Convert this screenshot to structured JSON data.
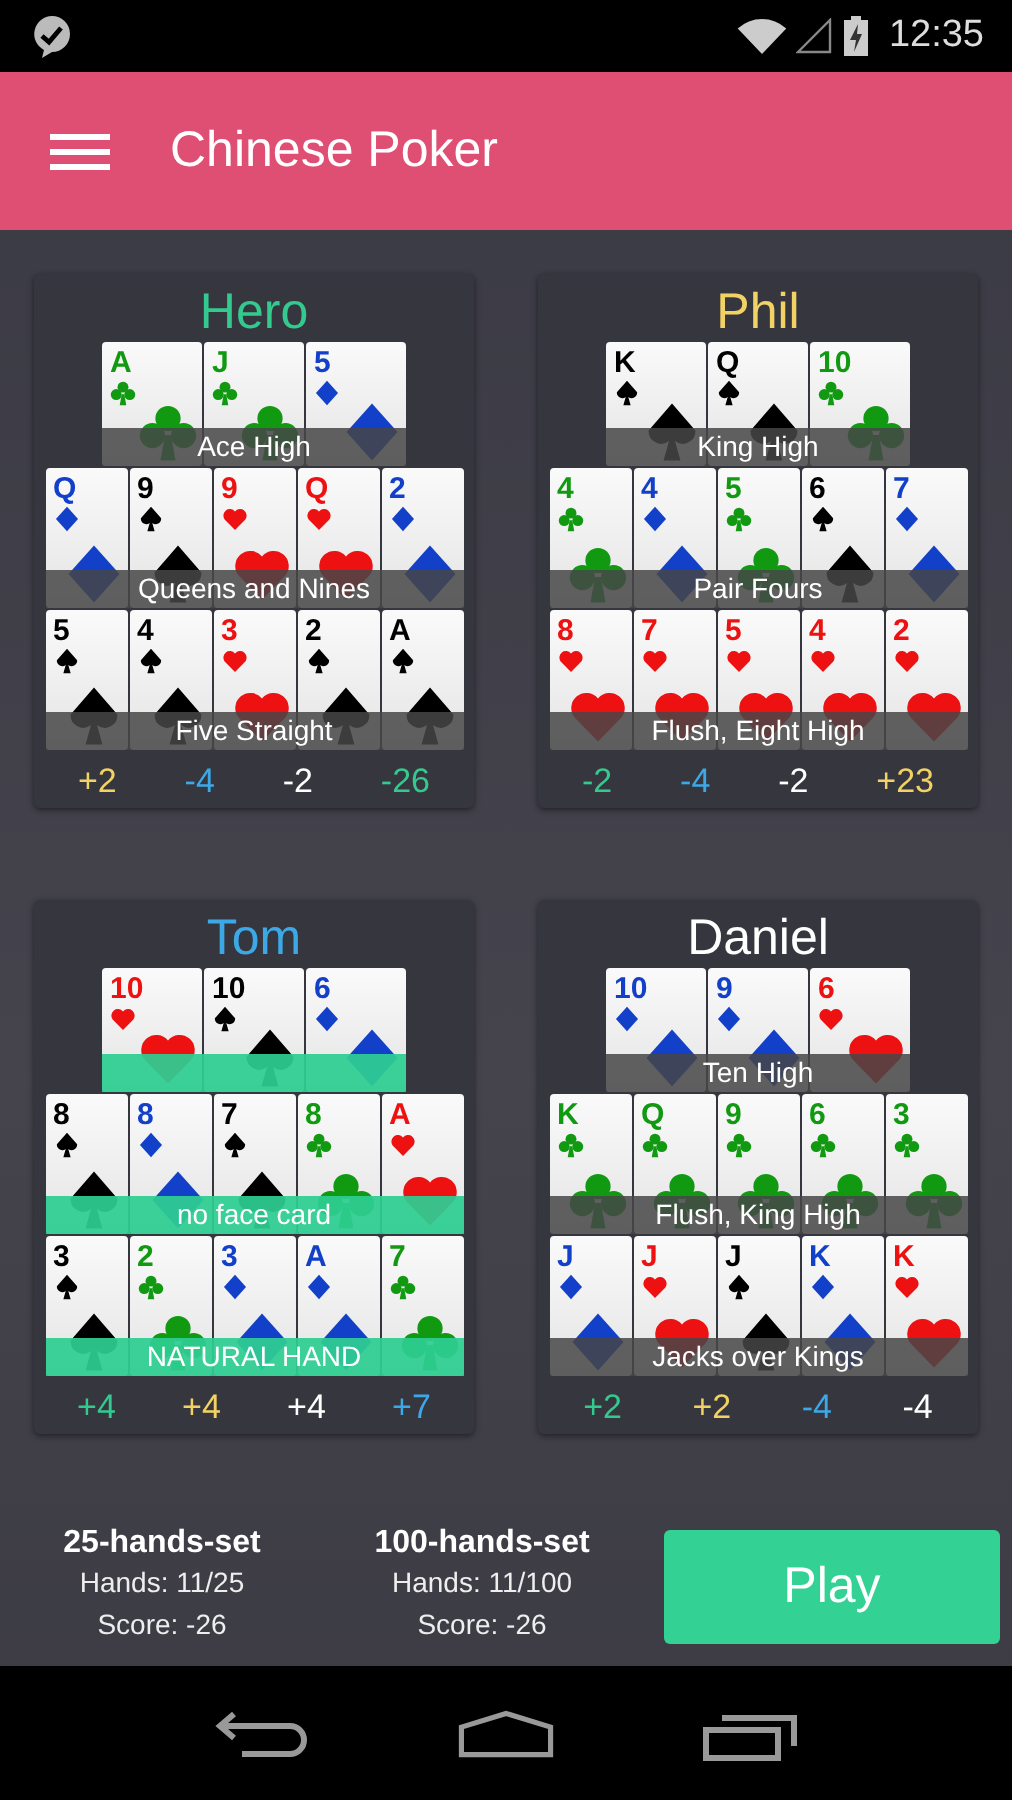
{
  "status_bar": {
    "time": "12:35"
  },
  "app_bar": {
    "title": "Chinese Poker"
  },
  "players": [
    {
      "name": "Hero",
      "color": "#34c98e",
      "rows": [
        {
          "label": "Ace High",
          "highlight": false,
          "cards": [
            {
              "rank": "A",
              "kind": "clubs"
            },
            {
              "rank": "J",
              "kind": "clubs"
            },
            {
              "rank": "5",
              "kind": "diamonds"
            }
          ]
        },
        {
          "label": "Queens and Nines",
          "highlight": false,
          "cards": [
            {
              "rank": "Q",
              "kind": "diamonds"
            },
            {
              "rank": "9",
              "kind": "spades"
            },
            {
              "rank": "9",
              "kind": "hearts"
            },
            {
              "rank": "Q",
              "kind": "hearts"
            },
            {
              "rank": "2",
              "kind": "diamonds"
            }
          ]
        },
        {
          "label": "Five Straight",
          "highlight": false,
          "cards": [
            {
              "rank": "5",
              "kind": "spades"
            },
            {
              "rank": "4",
              "kind": "spades"
            },
            {
              "rank": "3",
              "kind": "hearts"
            },
            {
              "rank": "2",
              "kind": "spades"
            },
            {
              "rank": "A",
              "kind": "spades"
            }
          ]
        }
      ],
      "scores": [
        {
          "text": "+2",
          "color": "#f2d264"
        },
        {
          "text": "-4",
          "color": "#3da8e6"
        },
        {
          "text": "-2",
          "color": "#ffffff"
        },
        {
          "text": "-26",
          "color": "#34c98e"
        }
      ]
    },
    {
      "name": "Phil",
      "color": "#f2d264",
      "rows": [
        {
          "label": "King High",
          "highlight": false,
          "cards": [
            {
              "rank": "K",
              "kind": "spades"
            },
            {
              "rank": "Q",
              "kind": "spades"
            },
            {
              "rank": "10",
              "kind": "clubs"
            }
          ]
        },
        {
          "label": "Pair Fours",
          "highlight": false,
          "cards": [
            {
              "rank": "4",
              "kind": "clubs"
            },
            {
              "rank": "4",
              "kind": "diamonds"
            },
            {
              "rank": "5",
              "kind": "clubs"
            },
            {
              "rank": "6",
              "kind": "spades"
            },
            {
              "rank": "7",
              "kind": "diamonds"
            }
          ]
        },
        {
          "label": "Flush, Eight High",
          "highlight": false,
          "cards": [
            {
              "rank": "8",
              "kind": "hearts"
            },
            {
              "rank": "7",
              "kind": "hearts"
            },
            {
              "rank": "5",
              "kind": "hearts"
            },
            {
              "rank": "4",
              "kind": "hearts"
            },
            {
              "rank": "2",
              "kind": "hearts"
            }
          ]
        }
      ],
      "scores": [
        {
          "text": "-2",
          "color": "#34c98e"
        },
        {
          "text": "-4",
          "color": "#3da8e6"
        },
        {
          "text": "-2",
          "color": "#ffffff"
        },
        {
          "text": "+23",
          "color": "#f2d264"
        }
      ]
    },
    {
      "name": "Tom",
      "color": "#3da8e6",
      "rows": [
        {
          "highlight": true,
          "cards": [
            {
              "rank": "10",
              "kind": "hearts"
            },
            {
              "rank": "10",
              "kind": "spades"
            },
            {
              "rank": "6",
              "kind": "diamonds"
            }
          ]
        },
        {
          "label": "no face card",
          "highlight": true,
          "cards": [
            {
              "rank": "8",
              "kind": "spades"
            },
            {
              "rank": "8",
              "kind": "diamonds"
            },
            {
              "rank": "7",
              "kind": "spades"
            },
            {
              "rank": "8",
              "kind": "clubs"
            },
            {
              "rank": "A",
              "kind": "hearts"
            }
          ]
        },
        {
          "label": "NATURAL HAND",
          "highlight": true,
          "cards": [
            {
              "rank": "3",
              "kind": "spades"
            },
            {
              "rank": "2",
              "kind": "clubs"
            },
            {
              "rank": "3",
              "kind": "diamonds"
            },
            {
              "rank": "A",
              "kind": "diamonds"
            },
            {
              "rank": "7",
              "kind": "clubs"
            }
          ]
        }
      ],
      "scores": [
        {
          "text": "+4",
          "color": "#34c98e"
        },
        {
          "text": "+4",
          "color": "#f2d264"
        },
        {
          "text": "+4",
          "color": "#ffffff"
        },
        {
          "text": "+7",
          "color": "#3da8e6"
        }
      ]
    },
    {
      "name": "Daniel",
      "color": "#ffffff",
      "rows": [
        {
          "label": "Ten High",
          "highlight": false,
          "cards": [
            {
              "rank": "10",
              "kind": "diamonds"
            },
            {
              "rank": "9",
              "kind": "diamonds"
            },
            {
              "rank": "6",
              "kind": "hearts"
            }
          ]
        },
        {
          "label": "Flush, King High",
          "highlight": false,
          "cards": [
            {
              "rank": "K",
              "kind": "clubs"
            },
            {
              "rank": "Q",
              "kind": "clubs"
            },
            {
              "rank": "9",
              "kind": "clubs"
            },
            {
              "rank": "6",
              "kind": "clubs"
            },
            {
              "rank": "3",
              "kind": "clubs"
            }
          ]
        },
        {
          "label": "Jacks over Kings",
          "highlight": false,
          "cards": [
            {
              "rank": "J",
              "kind": "diamonds"
            },
            {
              "rank": "J",
              "kind": "hearts"
            },
            {
              "rank": "J",
              "kind": "spades"
            },
            {
              "rank": "K",
              "kind": "diamonds"
            },
            {
              "rank": "K",
              "kind": "hearts"
            }
          ]
        }
      ],
      "scores": [
        {
          "text": "+2",
          "color": "#34c98e"
        },
        {
          "text": "+2",
          "color": "#f2d264"
        },
        {
          "text": "-4",
          "color": "#3da8e6"
        },
        {
          "text": "-4",
          "color": "#ffffff"
        }
      ]
    }
  ],
  "sets": [
    {
      "title": "25-hands-set",
      "hands": "Hands: 11/25",
      "score": "Score: -26"
    },
    {
      "title": "100-hands-set",
      "hands": "Hands: 11/100",
      "score": "Score: -26"
    }
  ],
  "play_button": "Play"
}
